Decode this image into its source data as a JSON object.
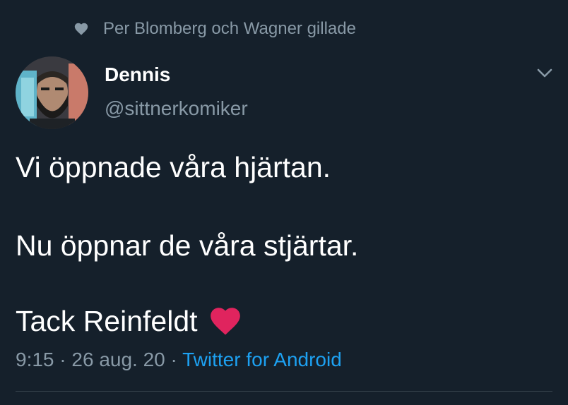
{
  "social_context": {
    "icon": "heart-icon",
    "text": "Per Blomberg och Wagner gillade"
  },
  "tweet": {
    "display_name": "Dennis",
    "handle": "@sittnerkomiker",
    "lines": [
      "Vi öppnade våra hjärtan.",
      "Nu öppnar de våra stjärtar.",
      "Tack Reinfeldt"
    ],
    "emoji": "red-heart-icon",
    "time": "9:15",
    "separator": "·",
    "date": "26 aug. 20",
    "source": "Twitter for Android"
  },
  "colors": {
    "background": "#15202b",
    "secondary_text": "#8899a6",
    "link": "#1da1f2",
    "heart": "#e0245e",
    "divider": "#38444d"
  }
}
